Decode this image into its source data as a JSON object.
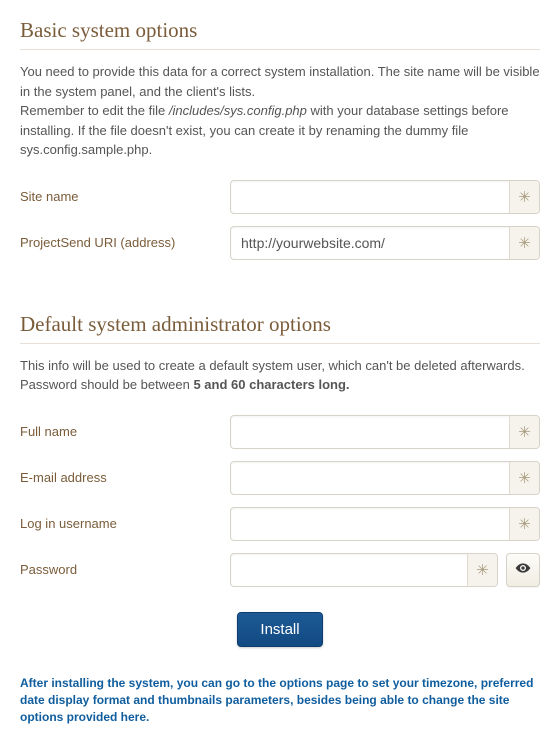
{
  "section1": {
    "heading": "Basic system options",
    "desc_part1": "You need to provide this data for a correct system installation. The site name will be visible in the system panel, and the client's lists.",
    "desc_part2a": "Remember to edit the file ",
    "desc_part2_file": "/includes/sys.config.php",
    "desc_part2b": " with your database settings before installing. If the file doesn't exist, you can create it by renaming the dummy file sys.config.sample.php.",
    "fields": {
      "sitename": {
        "label": "Site name",
        "value": ""
      },
      "uri": {
        "label": "ProjectSend URI (address)",
        "value": "http://yourwebsite.com/"
      }
    }
  },
  "section2": {
    "heading": "Default system administrator options",
    "desc_a": "This info will be used to create a default system user, which can't be deleted afterwards. Password should be between ",
    "desc_bold": "5 and 60 characters long.",
    "fields": {
      "fullname": {
        "label": "Full name",
        "value": ""
      },
      "email": {
        "label": "E-mail address",
        "value": ""
      },
      "username": {
        "label": "Log in username",
        "value": ""
      },
      "password": {
        "label": "Password",
        "value": ""
      }
    }
  },
  "required_glyph": "✳",
  "install_label": "Install",
  "footer_note": "After installing the system, you can go to the options page to set your timezone, preferred date display format and thumbnails parameters, besides being able to change the site options provided here."
}
